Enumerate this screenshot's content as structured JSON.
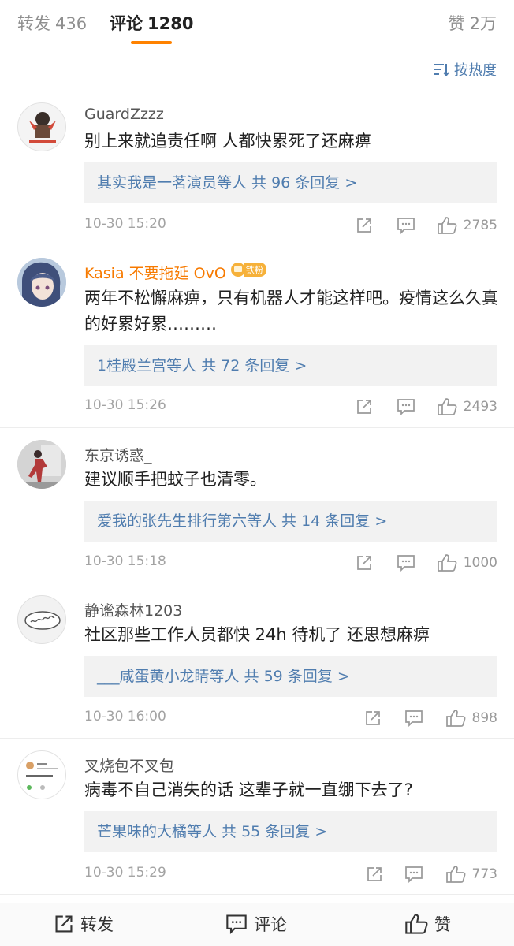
{
  "tabs": {
    "reposts": {
      "label": "转发",
      "count": "436"
    },
    "comments": {
      "label": "评论",
      "count": "1280"
    },
    "likes": {
      "label": "赞",
      "count": "2万"
    }
  },
  "sort": {
    "label": "按热度"
  },
  "colors": {
    "accent": "#ff8200",
    "link": "#507daf",
    "vip_name": "#f77a00"
  },
  "comments": [
    {
      "name": "GuardZzzz",
      "text": "别上来就追责任啊 人都快累死了还麻痹",
      "replies": "其实我是一茗演员等人  共 96 条回复 >",
      "time": "10-30 15:20",
      "likes": "2785"
    },
    {
      "name": "Kasia 不要拖延 OvO",
      "badge": "铁粉",
      "text": "两年不松懈麻痹，只有机器人才能这样吧。疫情这么久真的好累好累………",
      "replies": "1桂殿兰宫等人  共 72 条回复 >",
      "time": "10-30 15:26",
      "likes": "2493"
    },
    {
      "name": "东京诱惑_",
      "text": "建议顺手把蚊子也清零。",
      "replies": "爱我的张先生排行第六等人  共 14 条回复 >",
      "time": "10-30 15:18",
      "likes": "1000"
    },
    {
      "name": "静谧森林1203",
      "text": "社区那些工作人员都快 24h 待机了 还思想麻痹",
      "replies": "___咸蛋黄小龙睛等人  共 59 条回复 >",
      "time": "10-30 16:00",
      "likes": "898"
    },
    {
      "name": "叉烧包不叉包",
      "text": "病毒不自己消失的话 这辈子就一直绷下去了?",
      "replies": "芒果味的大橘等人  共 55 条回复 >",
      "time": "10-30 15:29",
      "likes": "773"
    }
  ],
  "bottom_bar": {
    "repost": "转发",
    "comment": "评论",
    "like": "赞"
  }
}
